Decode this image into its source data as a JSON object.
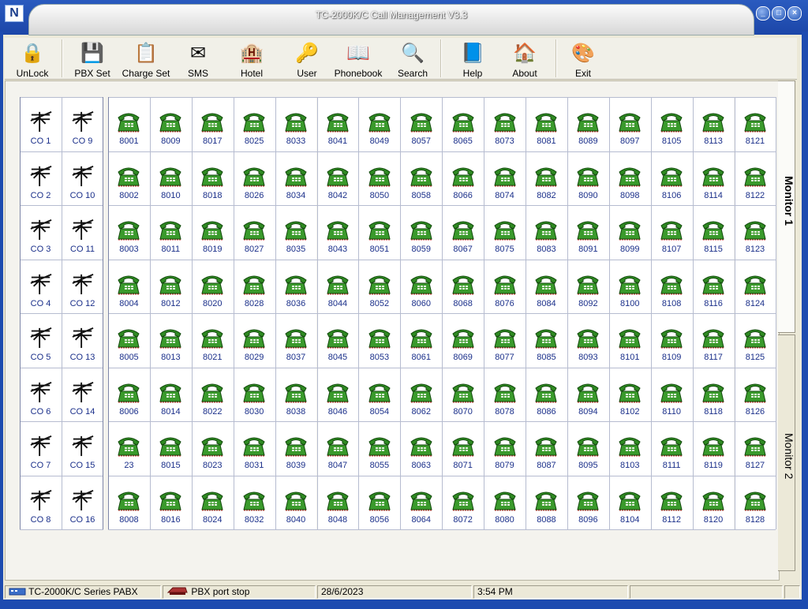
{
  "window": {
    "title": "TC-2000K/C Call Management V3.3",
    "logo": "N"
  },
  "toolbar": {
    "buttons": [
      {
        "label": "UnLock",
        "icon": "lock-icon",
        "glyph": "🔒"
      },
      {
        "label": "PBX Set",
        "icon": "chip-icon",
        "glyph": "💾"
      },
      {
        "label": "Charge Set",
        "icon": "charge-icon",
        "glyph": "📋"
      },
      {
        "label": "SMS",
        "icon": "envelope-icon",
        "glyph": "✉"
      },
      {
        "label": "Hotel",
        "icon": "hotel-icon",
        "glyph": "🏨"
      },
      {
        "label": "User",
        "icon": "keys-icon",
        "glyph": "🔑"
      },
      {
        "label": "Phonebook",
        "icon": "book-icon",
        "glyph": "📖"
      },
      {
        "label": "Search",
        "icon": "search-icon",
        "glyph": "🔍"
      },
      {
        "label": "Help",
        "icon": "help-book-icon",
        "glyph": "📘"
      },
      {
        "label": "About",
        "icon": "about-icon",
        "glyph": "🏠"
      },
      {
        "label": "Exit",
        "icon": "exit-icon",
        "glyph": "🎨"
      }
    ]
  },
  "co_lines": [
    [
      "CO 1",
      "CO 9"
    ],
    [
      "CO 2",
      "CO 10"
    ],
    [
      "CO 3",
      "CO 11"
    ],
    [
      "CO 4",
      "CO 12"
    ],
    [
      "CO 5",
      "CO 13"
    ],
    [
      "CO 6",
      "CO 14"
    ],
    [
      "CO 7",
      "CO 15"
    ],
    [
      "CO 8",
      "CO 16"
    ]
  ],
  "extensions": [
    [
      "8001",
      "8009",
      "8017",
      "8025",
      "8033",
      "8041",
      "8049",
      "8057",
      "8065",
      "8073",
      "8081",
      "8089",
      "8097",
      "8105",
      "8113",
      "8121"
    ],
    [
      "8002",
      "8010",
      "8018",
      "8026",
      "8034",
      "8042",
      "8050",
      "8058",
      "8066",
      "8074",
      "8082",
      "8090",
      "8098",
      "8106",
      "8114",
      "8122"
    ],
    [
      "8003",
      "8011",
      "8019",
      "8027",
      "8035",
      "8043",
      "8051",
      "8059",
      "8067",
      "8075",
      "8083",
      "8091",
      "8099",
      "8107",
      "8115",
      "8123"
    ],
    [
      "8004",
      "8012",
      "8020",
      "8028",
      "8036",
      "8044",
      "8052",
      "8060",
      "8068",
      "8076",
      "8084",
      "8092",
      "8100",
      "8108",
      "8116",
      "8124"
    ],
    [
      "8005",
      "8013",
      "8021",
      "8029",
      "8037",
      "8045",
      "8053",
      "8061",
      "8069",
      "8077",
      "8085",
      "8093",
      "8101",
      "8109",
      "8117",
      "8125"
    ],
    [
      "8006",
      "8014",
      "8022",
      "8030",
      "8038",
      "8046",
      "8054",
      "8062",
      "8070",
      "8078",
      "8086",
      "8094",
      "8102",
      "8110",
      "8118",
      "8126"
    ],
    [
      "23",
      "8015",
      "8023",
      "8031",
      "8039",
      "8047",
      "8055",
      "8063",
      "8071",
      "8079",
      "8087",
      "8095",
      "8103",
      "8111",
      "8119",
      "8127"
    ],
    [
      "8008",
      "8016",
      "8024",
      "8032",
      "8040",
      "8048",
      "8056",
      "8064",
      "8072",
      "8080",
      "8088",
      "8096",
      "8104",
      "8112",
      "8120",
      "8128"
    ]
  ],
  "tabs": [
    {
      "label": "Monitor 1",
      "active": true
    },
    {
      "label": "Monitor 2",
      "active": false
    }
  ],
  "statusbar": {
    "model": "TC-2000K/C Series PABX",
    "port_status": "PBX port stop",
    "date": "28/6/2023",
    "time": "3:54 PM",
    "extra1": "",
    "extra2": ""
  },
  "colors": {
    "phone_green": "#2f8a22",
    "label_blue": "#1a2f8a",
    "title_blue": "#1d4bb0"
  }
}
